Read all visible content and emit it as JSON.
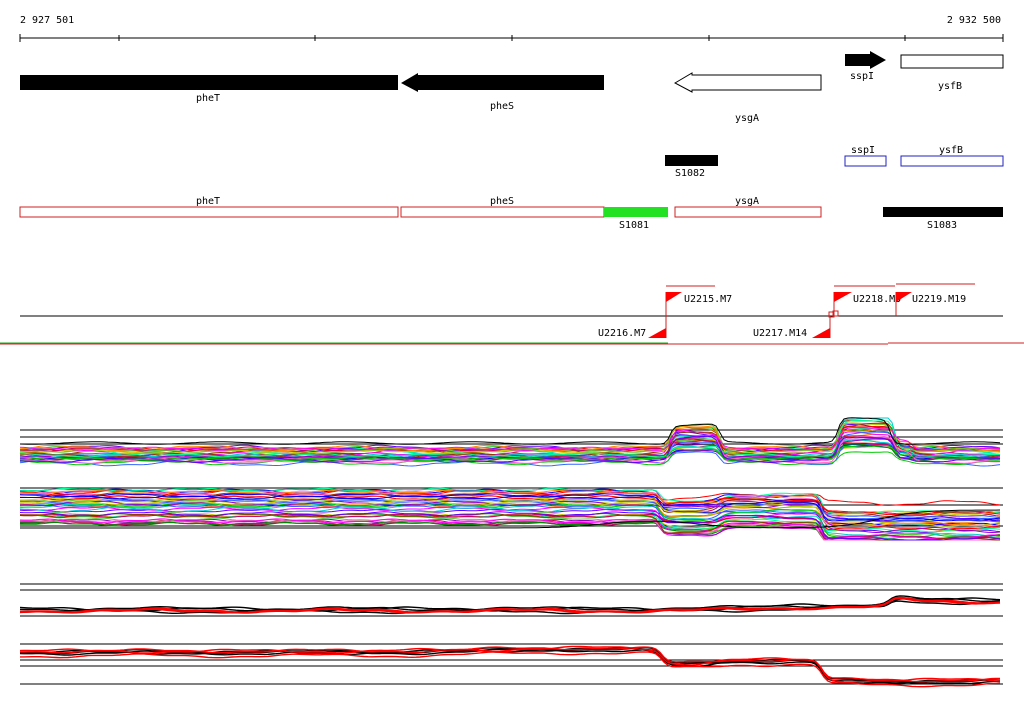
{
  "coordinates": {
    "start_label": "2 927 501",
    "end_label": "2 932 500",
    "start": 2927501,
    "end": 2932500
  },
  "colors": {
    "feature_solid": "#000000",
    "operon_outline": "#d02020",
    "transcript_outline": "#2020c0",
    "highlight": "#22e022",
    "flag": "#ff0000",
    "reference_line": "#000000",
    "cyan_line": "#22aa22"
  },
  "genes_top": [
    {
      "label": "pheT",
      "strand": "-",
      "filled": true,
      "start": 2927501,
      "end": 2929420
    },
    {
      "label": "pheS",
      "strand": "-",
      "filled": true,
      "start": 2929430,
      "end": 2930440
    },
    {
      "label": "ysgA",
      "strand": "-",
      "filled": false,
      "start": 2930780,
      "end": 2931530
    },
    {
      "label": "sspI",
      "strand": "+",
      "filled": true,
      "start": 2931620,
      "end": 2931830
    },
    {
      "label": "ysfB",
      "strand": "+",
      "filled": false,
      "start": 2931900,
      "end": 2932430
    }
  ],
  "transcripts_mid": [
    {
      "label": "S1082",
      "style": "solid",
      "start": 2930800,
      "end": 2931060
    },
    {
      "label": "sspI",
      "style": "blue-outline",
      "start": 2931620,
      "end": 2931830
    },
    {
      "label": "ysfB",
      "style": "blue-outline",
      "start": 2931900,
      "end": 2932430
    }
  ],
  "operon_row": [
    {
      "label": "pheT",
      "style": "red-outline",
      "start": 2927501,
      "end": 2929420
    },
    {
      "label": "pheS",
      "style": "red-outline",
      "start": 2929430,
      "end": 2930440
    },
    {
      "label": "S1081",
      "style": "green",
      "start": 2930440,
      "end": 2930760
    },
    {
      "label": "ysgA",
      "style": "red-outline",
      "start": 2930780,
      "end": 2931530
    },
    {
      "label": "S1083",
      "style": "solid",
      "start": 2931820,
      "end": 2932430
    }
  ],
  "upshifts": [
    {
      "label": "U2215.M7",
      "strand": "+",
      "pos": 2930760
    },
    {
      "label": "U2216.M7",
      "strand": "-",
      "pos": 2930760
    },
    {
      "label": "U2217.M14",
      "strand": "-",
      "pos": 2931570
    },
    {
      "label": "U2218.M5",
      "strand": "+",
      "pos": 2931600
    },
    {
      "label": "U2219.M19",
      "strand": "+",
      "pos": 2931890
    }
  ]
}
